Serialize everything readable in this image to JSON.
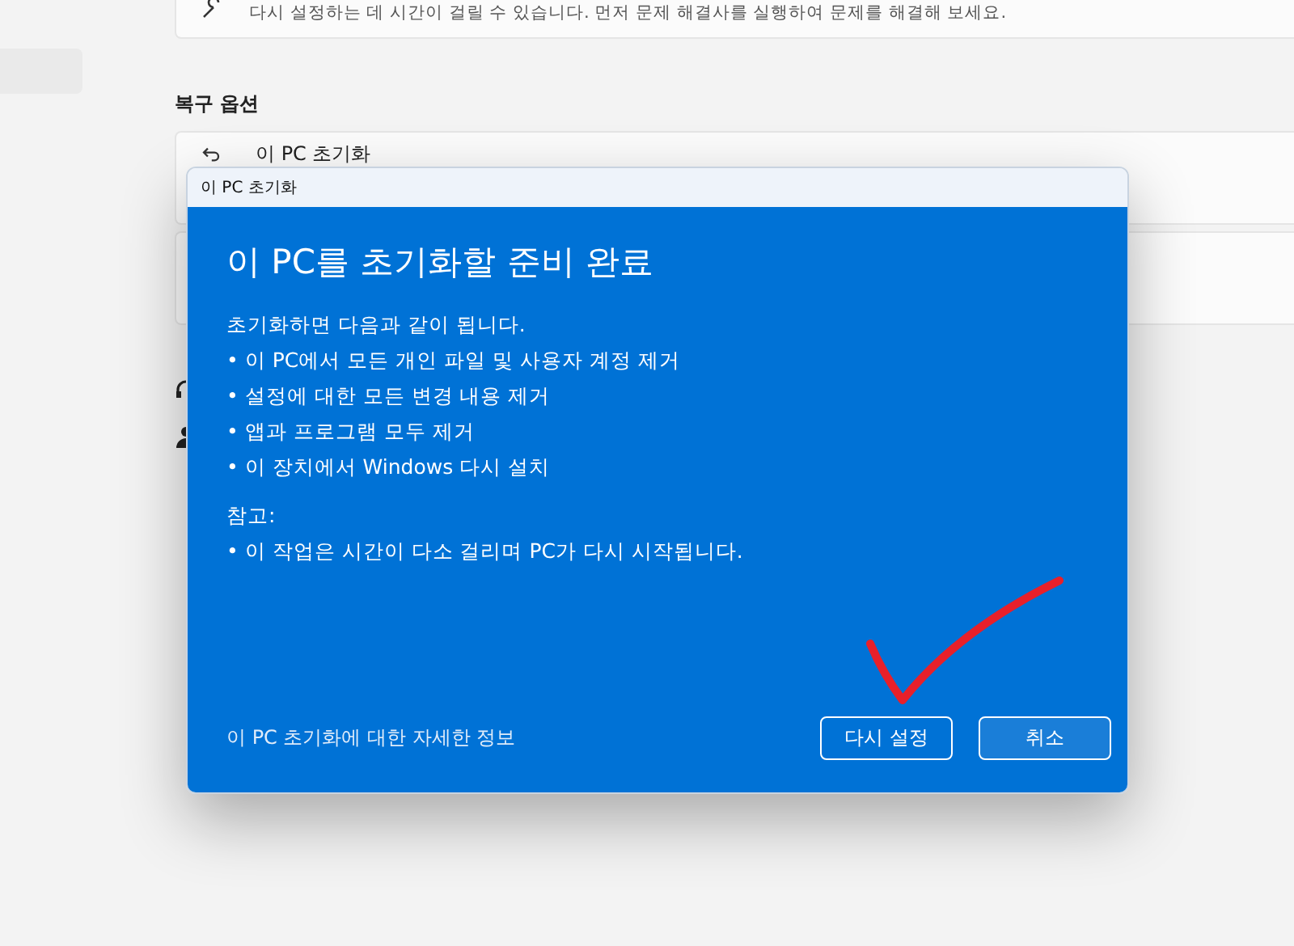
{
  "background": {
    "notice_text": "다시 설정하는 데 시간이 걸릴 수 있습니다. 먼저 문제 해결사를 실행하여 문제를 해결해 보세요.",
    "section_title": "복구 옵션",
    "recovery_item": "이 PC 초기화"
  },
  "dialog": {
    "title": "이 PC 초기화",
    "heading": "이 PC를 초기화할 준비 완료",
    "intro": "초기화하면 다음과 같이 됩니다.",
    "bullets": [
      "•  이 PC에서 모든 개인 파일 및 사용자 계정 제거",
      "•  설정에 대한 모든 변경 내용 제거",
      "•  앱과 프로그램 모두 제거",
      "• 이 장치에서 Windows 다시 설치"
    ],
    "note_label": "참고:",
    "note_bullets": [
      "•  이 작업은 시간이 다소 걸리며 PC가 다시 시작됩니다."
    ],
    "link": "이 PC 초기화에 대한 자세한 정보",
    "buttons": [
      {
        "label": "다시 설정",
        "kind": "outline"
      },
      {
        "label": "취소",
        "kind": "filled"
      }
    ]
  }
}
